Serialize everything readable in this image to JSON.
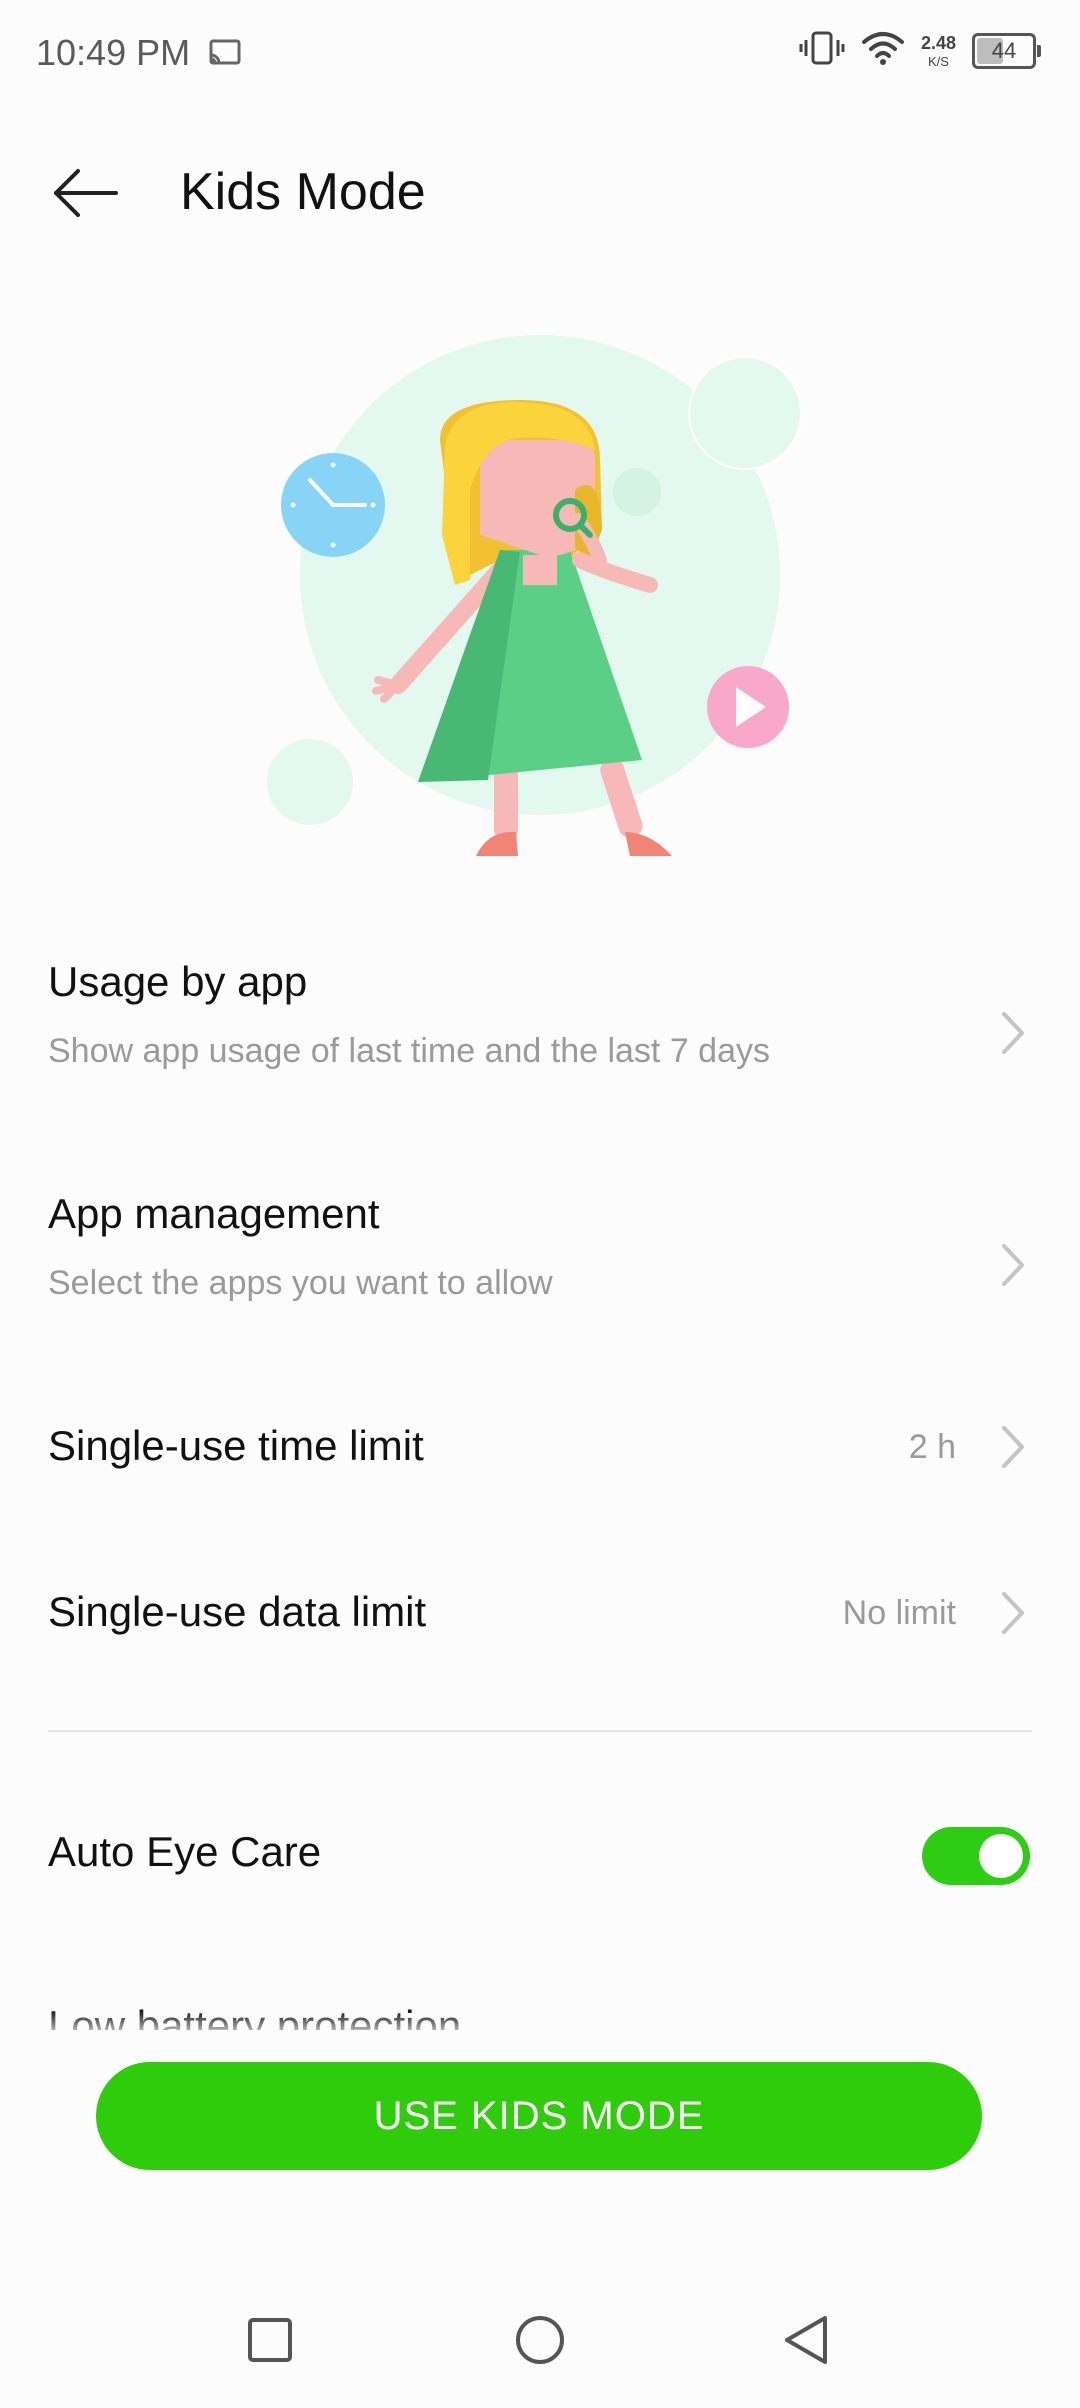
{
  "status_bar": {
    "time": "10:49 PM",
    "net_speed_value": "2.48",
    "net_speed_unit": "K/S",
    "battery_level": "44"
  },
  "app_bar": {
    "title": "Kids Mode"
  },
  "settings": {
    "usage_by_app": {
      "title": "Usage by app",
      "subtitle": "Show app usage of last time and the last 7 days"
    },
    "app_management": {
      "title": "App management",
      "subtitle": "Select the apps you want to allow"
    },
    "single_use_time_limit": {
      "title": "Single-use time limit",
      "value": "2 h"
    },
    "single_use_data_limit": {
      "title": "Single-use data limit",
      "value": "No limit"
    },
    "auto_eye_care": {
      "title": "Auto Eye Care",
      "enabled": true
    },
    "low_battery_protection": {
      "title": "Low battery protection"
    }
  },
  "cta": {
    "label": "USE KIDS MODE"
  },
  "colors": {
    "accent": "#2ECC0B",
    "toggle_on": "#2ECC15",
    "illustration_bg": "#E3F8EF"
  }
}
